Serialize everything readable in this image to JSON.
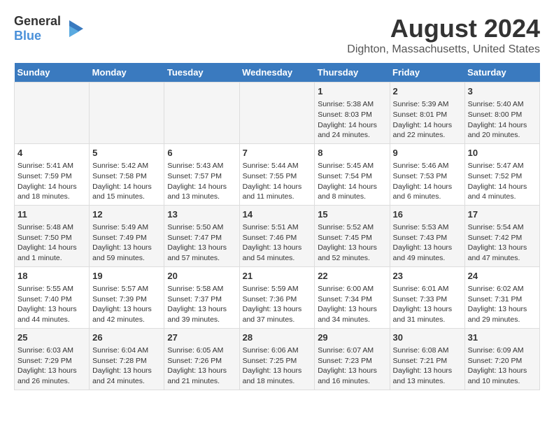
{
  "logo": {
    "line1": "General",
    "line2": "Blue"
  },
  "title": "August 2024",
  "subtitle": "Dighton, Massachusetts, United States",
  "days_of_week": [
    "Sunday",
    "Monday",
    "Tuesday",
    "Wednesday",
    "Thursday",
    "Friday",
    "Saturday"
  ],
  "weeks": [
    [
      {
        "day": "",
        "content": ""
      },
      {
        "day": "",
        "content": ""
      },
      {
        "day": "",
        "content": ""
      },
      {
        "day": "",
        "content": ""
      },
      {
        "day": "1",
        "content": "Sunrise: 5:38 AM\nSunset: 8:03 PM\nDaylight: 14 hours and 24 minutes."
      },
      {
        "day": "2",
        "content": "Sunrise: 5:39 AM\nSunset: 8:01 PM\nDaylight: 14 hours and 22 minutes."
      },
      {
        "day": "3",
        "content": "Sunrise: 5:40 AM\nSunset: 8:00 PM\nDaylight: 14 hours and 20 minutes."
      }
    ],
    [
      {
        "day": "4",
        "content": "Sunrise: 5:41 AM\nSunset: 7:59 PM\nDaylight: 14 hours and 18 minutes."
      },
      {
        "day": "5",
        "content": "Sunrise: 5:42 AM\nSunset: 7:58 PM\nDaylight: 14 hours and 15 minutes."
      },
      {
        "day": "6",
        "content": "Sunrise: 5:43 AM\nSunset: 7:57 PM\nDaylight: 14 hours and 13 minutes."
      },
      {
        "day": "7",
        "content": "Sunrise: 5:44 AM\nSunset: 7:55 PM\nDaylight: 14 hours and 11 minutes."
      },
      {
        "day": "8",
        "content": "Sunrise: 5:45 AM\nSunset: 7:54 PM\nDaylight: 14 hours and 8 minutes."
      },
      {
        "day": "9",
        "content": "Sunrise: 5:46 AM\nSunset: 7:53 PM\nDaylight: 14 hours and 6 minutes."
      },
      {
        "day": "10",
        "content": "Sunrise: 5:47 AM\nSunset: 7:52 PM\nDaylight: 14 hours and 4 minutes."
      }
    ],
    [
      {
        "day": "11",
        "content": "Sunrise: 5:48 AM\nSunset: 7:50 PM\nDaylight: 14 hours and 1 minute."
      },
      {
        "day": "12",
        "content": "Sunrise: 5:49 AM\nSunset: 7:49 PM\nDaylight: 13 hours and 59 minutes."
      },
      {
        "day": "13",
        "content": "Sunrise: 5:50 AM\nSunset: 7:47 PM\nDaylight: 13 hours and 57 minutes."
      },
      {
        "day": "14",
        "content": "Sunrise: 5:51 AM\nSunset: 7:46 PM\nDaylight: 13 hours and 54 minutes."
      },
      {
        "day": "15",
        "content": "Sunrise: 5:52 AM\nSunset: 7:45 PM\nDaylight: 13 hours and 52 minutes."
      },
      {
        "day": "16",
        "content": "Sunrise: 5:53 AM\nSunset: 7:43 PM\nDaylight: 13 hours and 49 minutes."
      },
      {
        "day": "17",
        "content": "Sunrise: 5:54 AM\nSunset: 7:42 PM\nDaylight: 13 hours and 47 minutes."
      }
    ],
    [
      {
        "day": "18",
        "content": "Sunrise: 5:55 AM\nSunset: 7:40 PM\nDaylight: 13 hours and 44 minutes."
      },
      {
        "day": "19",
        "content": "Sunrise: 5:57 AM\nSunset: 7:39 PM\nDaylight: 13 hours and 42 minutes."
      },
      {
        "day": "20",
        "content": "Sunrise: 5:58 AM\nSunset: 7:37 PM\nDaylight: 13 hours and 39 minutes."
      },
      {
        "day": "21",
        "content": "Sunrise: 5:59 AM\nSunset: 7:36 PM\nDaylight: 13 hours and 37 minutes."
      },
      {
        "day": "22",
        "content": "Sunrise: 6:00 AM\nSunset: 7:34 PM\nDaylight: 13 hours and 34 minutes."
      },
      {
        "day": "23",
        "content": "Sunrise: 6:01 AM\nSunset: 7:33 PM\nDaylight: 13 hours and 31 minutes."
      },
      {
        "day": "24",
        "content": "Sunrise: 6:02 AM\nSunset: 7:31 PM\nDaylight: 13 hours and 29 minutes."
      }
    ],
    [
      {
        "day": "25",
        "content": "Sunrise: 6:03 AM\nSunset: 7:29 PM\nDaylight: 13 hours and 26 minutes."
      },
      {
        "day": "26",
        "content": "Sunrise: 6:04 AM\nSunset: 7:28 PM\nDaylight: 13 hours and 24 minutes."
      },
      {
        "day": "27",
        "content": "Sunrise: 6:05 AM\nSunset: 7:26 PM\nDaylight: 13 hours and 21 minutes."
      },
      {
        "day": "28",
        "content": "Sunrise: 6:06 AM\nSunset: 7:25 PM\nDaylight: 13 hours and 18 minutes."
      },
      {
        "day": "29",
        "content": "Sunrise: 6:07 AM\nSunset: 7:23 PM\nDaylight: 13 hours and 16 minutes."
      },
      {
        "day": "30",
        "content": "Sunrise: 6:08 AM\nSunset: 7:21 PM\nDaylight: 13 hours and 13 minutes."
      },
      {
        "day": "31",
        "content": "Sunrise: 6:09 AM\nSunset: 7:20 PM\nDaylight: 13 hours and 10 minutes."
      }
    ]
  ]
}
